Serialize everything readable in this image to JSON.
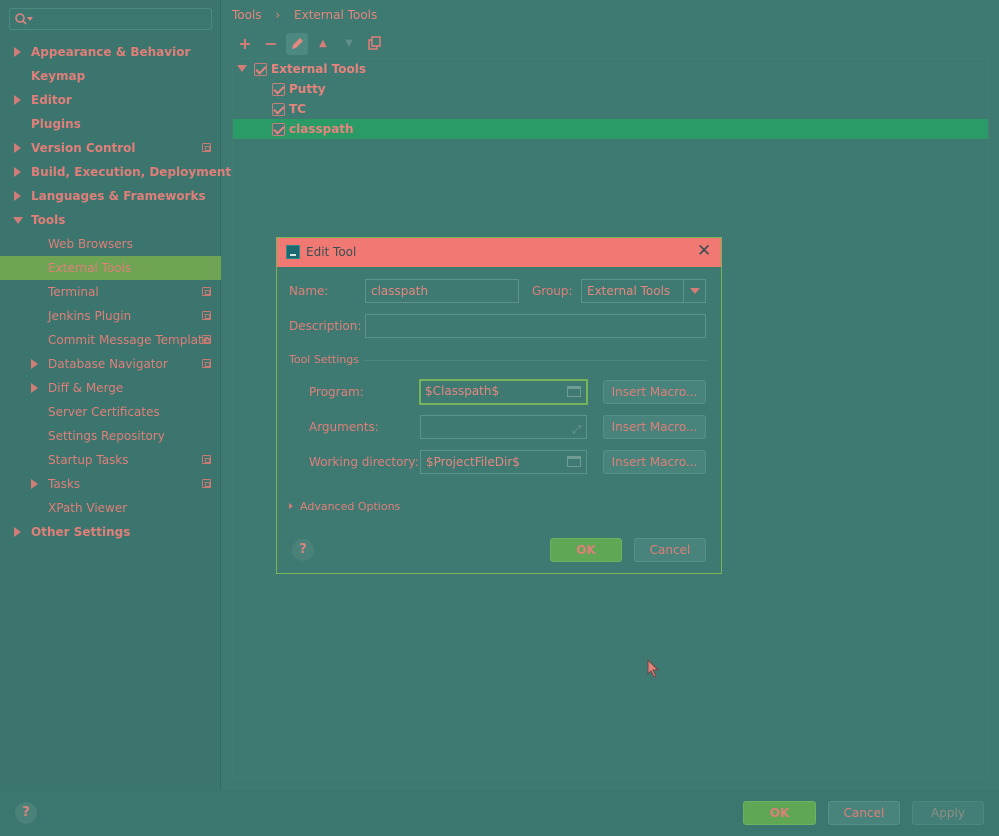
{
  "sidebar": {
    "search_placeholder": "",
    "items": [
      {
        "label": "Appearance & Behavior"
      },
      {
        "label": "Keymap"
      },
      {
        "label": "Editor"
      },
      {
        "label": "Plugins"
      },
      {
        "label": "Version Control"
      },
      {
        "label": "Build, Execution, Deployment"
      },
      {
        "label": "Languages & Frameworks"
      },
      {
        "label": "Tools"
      },
      {
        "label": "Web Browsers"
      },
      {
        "label": "External Tools"
      },
      {
        "label": "Terminal"
      },
      {
        "label": "Jenkins Plugin"
      },
      {
        "label": "Commit Message Template"
      },
      {
        "label": "Database Navigator"
      },
      {
        "label": "Diff & Merge"
      },
      {
        "label": "Server Certificates"
      },
      {
        "label": "Settings Repository"
      },
      {
        "label": "Startup Tasks"
      },
      {
        "label": "Tasks"
      },
      {
        "label": "XPath Viewer"
      },
      {
        "label": "Other Settings"
      }
    ],
    "help_label": "?"
  },
  "breadcrumb": {
    "root": "Tools",
    "sep": "›",
    "leaf": "External Tools"
  },
  "toolbar": {
    "add": "+",
    "remove": "−",
    "up": "▲",
    "down": "▼"
  },
  "tools_tree": {
    "group": "External Tools",
    "tools": [
      "Putty",
      "TC",
      "classpath"
    ]
  },
  "dialog": {
    "title": "Edit Tool",
    "close": "✕",
    "name_label": "Name:",
    "name_value": "classpath",
    "group_label": "Group:",
    "group_value": "External Tools",
    "description_label": "Description:",
    "description_value": "",
    "tool_settings_label": "Tool Settings",
    "program_label": "Program:",
    "program_value": "$Classpath$",
    "arguments_label": "Arguments:",
    "arguments_value": "",
    "workdir_label": "Working directory:",
    "workdir_value": "$ProjectFileDir$",
    "insert_macro": "Insert Macro...",
    "advanced_label": "Advanced Options",
    "help": "?",
    "ok": "OK",
    "cancel": "Cancel"
  },
  "footer": {
    "help": "?",
    "ok": "OK",
    "cancel": "Cancel",
    "apply": "Apply"
  },
  "colors": {
    "selection": "#6ea453",
    "primary_button": "#5fa655",
    "title_bar": "#f07a73",
    "tree_selection": "#2a9a67"
  }
}
